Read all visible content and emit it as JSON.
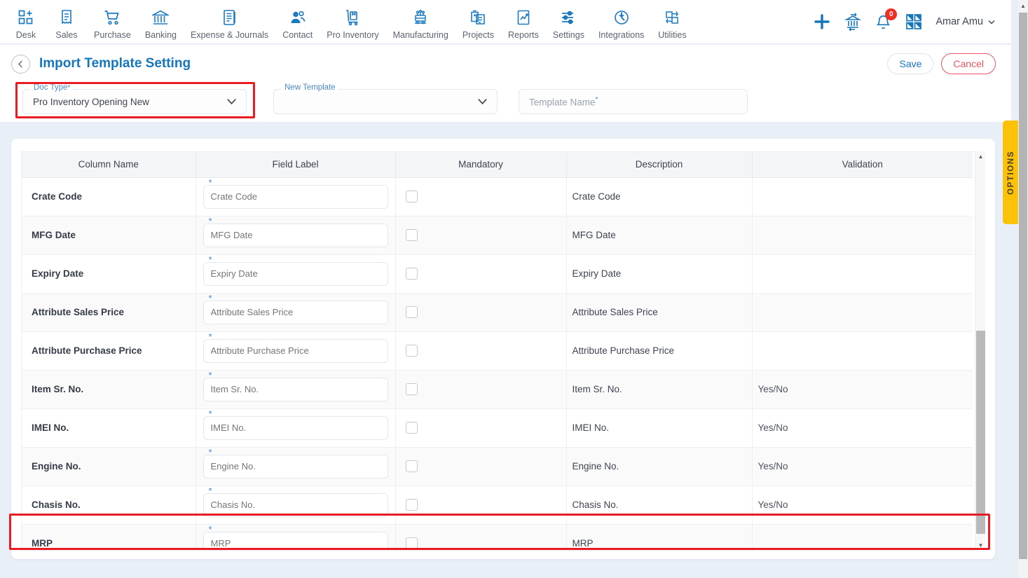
{
  "nav": {
    "items": [
      {
        "label": "Desk",
        "icon": "desk-grid-plus-icon"
      },
      {
        "label": "Sales",
        "icon": "sales-receipt-icon"
      },
      {
        "label": "Purchase",
        "icon": "purchase-cart-icon"
      },
      {
        "label": "Banking",
        "icon": "banking-bank-icon"
      },
      {
        "label": "Expense & Journals",
        "icon": "expense-journal-icon"
      },
      {
        "label": "Contact",
        "icon": "contact-people-icon"
      },
      {
        "label": "Pro Inventory",
        "icon": "pro-inventory-trolley-icon"
      },
      {
        "label": "Manufacturing",
        "icon": "manufacturing-machine-icon"
      },
      {
        "label": "Projects",
        "icon": "projects-clipboard-icon"
      },
      {
        "label": "Reports",
        "icon": "reports-chart-icon"
      },
      {
        "label": "Settings",
        "icon": "settings-sliders-icon"
      },
      {
        "label": "Integrations",
        "icon": "integrations-plug-icon"
      },
      {
        "label": "Utilities",
        "icon": "utilities-shuffle-icon"
      }
    ],
    "right": {
      "add_icon": "plus-icon",
      "transfer_icon": "bank-transfer-icon",
      "bell_icon": "notification-bell-icon",
      "notification_count": "0",
      "apps_icon": "apps-grid-icon",
      "user_name": "Amar Amu",
      "user_chevron_icon": "chevron-down-icon"
    }
  },
  "header": {
    "back_icon": "back-chevron-icon",
    "title": "Import Template Setting",
    "save_label": "Save",
    "cancel_label": "Cancel"
  },
  "filters": {
    "doc_type": {
      "legend": "Doc Type",
      "required_mark": "*",
      "value": "Pro Inventory Opening New",
      "chevron_icon": "chevron-down-icon",
      "highlighted": true
    },
    "new_template": {
      "legend": "New Template",
      "value": "",
      "chevron_icon": "chevron-down-icon"
    },
    "template_name": {
      "placeholder": "Template Name",
      "required_mark": "*",
      "value": ""
    }
  },
  "table": {
    "columns": [
      "Column Name",
      "Field Label",
      "Mandatory",
      "Description",
      "Validation"
    ],
    "rows": [
      {
        "column_name": "Crate Code",
        "field_label": "Crate Code",
        "mandatory": false,
        "description": "Crate Code",
        "validation": "",
        "highlighted": false
      },
      {
        "column_name": "MFG Date",
        "field_label": "MFG Date",
        "mandatory": false,
        "description": "MFG Date",
        "validation": "",
        "highlighted": false
      },
      {
        "column_name": "Expiry Date",
        "field_label": "Expiry Date",
        "mandatory": false,
        "description": "Expiry Date",
        "validation": "",
        "highlighted": false
      },
      {
        "column_name": "Attribute Sales Price",
        "field_label": "Attribute Sales Price",
        "mandatory": false,
        "description": "Attribute Sales Price",
        "validation": "",
        "highlighted": false
      },
      {
        "column_name": "Attribute Purchase Price",
        "field_label": "Attribute Purchase Price",
        "mandatory": false,
        "description": "Attribute Purchase Price",
        "validation": "",
        "highlighted": false
      },
      {
        "column_name": "Item Sr. No.",
        "field_label": "Item Sr. No.",
        "mandatory": false,
        "description": "Item Sr. No.",
        "validation": "Yes/No",
        "highlighted": false
      },
      {
        "column_name": "IMEI No.",
        "field_label": "IMEI No.",
        "mandatory": false,
        "description": "IMEI No.",
        "validation": "Yes/No",
        "highlighted": false
      },
      {
        "column_name": "Engine No.",
        "field_label": "Engine No.",
        "mandatory": false,
        "description": "Engine No.",
        "validation": "Yes/No",
        "highlighted": false
      },
      {
        "column_name": "Chasis No.",
        "field_label": "Chasis No.",
        "mandatory": false,
        "description": "Chasis No.",
        "validation": "Yes/No",
        "highlighted": false
      },
      {
        "column_name": "MRP",
        "field_label": "MRP",
        "mandatory": false,
        "description": "MRP",
        "validation": "",
        "highlighted": true
      }
    ]
  },
  "options_tab": {
    "label": "OPTIONS"
  },
  "colors": {
    "accent_blue": "#1576bc",
    "highlight_red": "#e81c22",
    "cancel_red": "#e8555f",
    "options_yellow": "#fcc209",
    "badge_red": "#ef2e24",
    "page_bg": "#e9eff7"
  }
}
